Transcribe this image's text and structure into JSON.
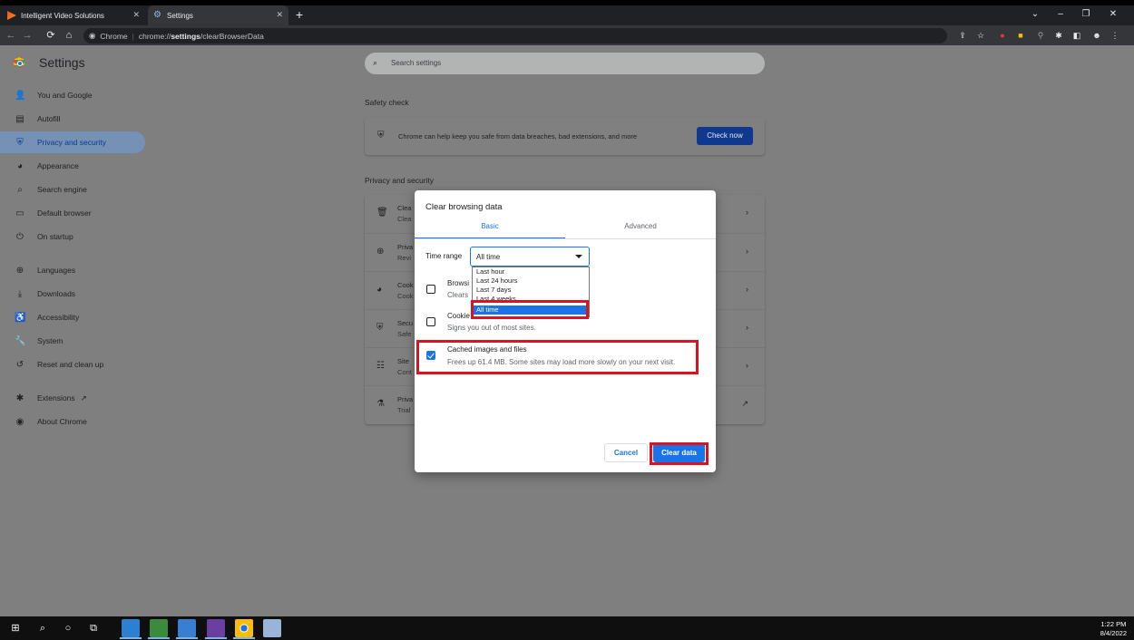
{
  "browser": {
    "tabs": [
      {
        "title": "Intelligent Video Solutions",
        "active": false
      },
      {
        "title": "Settings",
        "active": true
      }
    ],
    "new_tab_label": "+",
    "window_controls": [
      "chevron-down",
      "minimize",
      "restore",
      "close"
    ],
    "address": {
      "prefix": "Chrome",
      "url_host": "chrome://",
      "url_bold": "settings",
      "url_path": "/clearBrowserData"
    }
  },
  "settings": {
    "title": "Settings",
    "search_placeholder": "Search settings",
    "sidebar": [
      {
        "label": "You and Google",
        "icon": "person-icon",
        "glyph": "👤"
      },
      {
        "label": "Autofill",
        "icon": "clipboard-icon",
        "glyph": "▤"
      },
      {
        "label": "Privacy and security",
        "icon": "shield-icon",
        "glyph": "⛨",
        "selected": true
      },
      {
        "label": "Appearance",
        "icon": "palette-icon",
        "glyph": "◕"
      },
      {
        "label": "Search engine",
        "icon": "search-icon",
        "glyph": "⌕"
      },
      {
        "label": "Default browser",
        "icon": "browser-icon",
        "glyph": "▭"
      },
      {
        "label": "On startup",
        "icon": "power-icon",
        "glyph": "⏻"
      },
      {
        "label": "Languages",
        "icon": "globe-icon",
        "glyph": "⊕"
      },
      {
        "label": "Downloads",
        "icon": "download-icon",
        "glyph": "⤓"
      },
      {
        "label": "Accessibility",
        "icon": "accessibility-icon",
        "glyph": "♿"
      },
      {
        "label": "System",
        "icon": "wrench-icon",
        "glyph": "🔧"
      },
      {
        "label": "Reset and clean up",
        "icon": "reset-icon",
        "glyph": "↺"
      },
      {
        "label": "Extensions",
        "icon": "puzzle-icon",
        "glyph": "✱"
      },
      {
        "label": "About Chrome",
        "icon": "chrome-icon",
        "glyph": "◉"
      }
    ],
    "safety_check": {
      "heading": "Safety check",
      "text": "Chrome can help keep you safe from data breaches, bad extensions, and more",
      "button": "Check now"
    },
    "privacy": {
      "heading": "Privacy and security",
      "rows": [
        {
          "title": "Clea",
          "sub": "Clea"
        },
        {
          "title": "Priva",
          "sub": "Revi"
        },
        {
          "title": "Cook",
          "sub": "Cook"
        },
        {
          "title": "Secu",
          "sub": "Safe"
        },
        {
          "title": "Site",
          "sub": "Cont"
        },
        {
          "title": "Priva",
          "sub": "Trial"
        }
      ]
    }
  },
  "dialog": {
    "title": "Clear browsing data",
    "tabs": [
      "Basic",
      "Advanced"
    ],
    "time_range_label": "Time range",
    "time_range_value": "All time",
    "time_range_options": [
      "Last hour",
      "Last 24 hours",
      "Last 7 days",
      "Last 4 weeks",
      "All time"
    ],
    "options": [
      {
        "title": "Browsi",
        "sub": "Clears",
        "checked": false
      },
      {
        "title": "Cookie",
        "sub": "Signs you out of most sites.",
        "checked": false
      },
      {
        "title": "Cached images and files",
        "sub": "Frees up 61.4 MB. Some sites may load more slowly on your next visit.",
        "checked": true
      }
    ],
    "cancel": "Cancel",
    "confirm": "Clear data"
  },
  "taskbar": {
    "time": "1:22 PM",
    "date": "8/4/2022"
  },
  "colors": {
    "accent": "#1a73e8",
    "highlight": "#d9141f",
    "overlay": "#7f7f7f"
  }
}
